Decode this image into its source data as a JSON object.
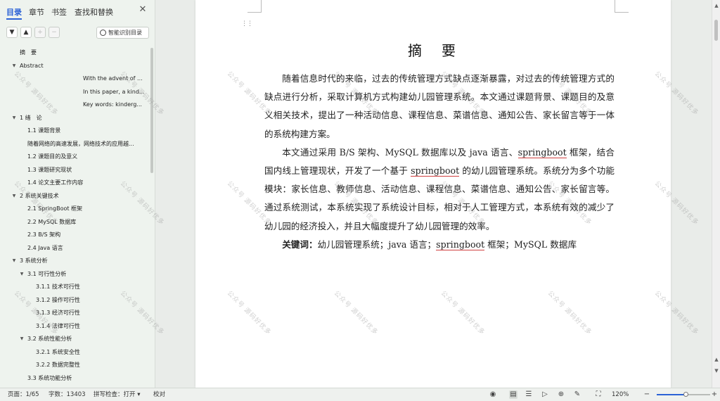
{
  "nav": {
    "tabs": [
      {
        "label": "目录",
        "active": true
      },
      {
        "label": "章节",
        "active": false
      },
      {
        "label": "书签",
        "active": false
      },
      {
        "label": "查找和替换",
        "active": false
      }
    ],
    "close_icon": "close-icon",
    "tools": {
      "collapse_icon": "chevron-down-icon",
      "expand_icon": "chevron-up-icon",
      "add_icon": "plus-icon",
      "remove_icon": "minus-icon",
      "smart_label": "智能识别目录"
    },
    "outline": [
      {
        "label": "摘　要",
        "level": 1,
        "caret": false
      },
      {
        "label": "Abstract",
        "level": 1,
        "caret": true
      },
      {
        "label": "With the advent of ...",
        "level": 4,
        "caret": false
      },
      {
        "label": "In this paper, a kind...",
        "level": 4,
        "caret": false
      },
      {
        "label": "Key words: kinderg...",
        "level": 4,
        "caret": false
      },
      {
        "label": "1  绪　论",
        "level": 1,
        "caret": true
      },
      {
        "label": "1.1 课题背景",
        "level": 2,
        "caret": false
      },
      {
        "label": "随着网络的高速发展，网络技术的应用越...",
        "level": 2,
        "caret": false
      },
      {
        "label": "1.2  课题目的及意义",
        "level": 2,
        "caret": false
      },
      {
        "label": "1.3 课题研究现状",
        "level": 2,
        "caret": false
      },
      {
        "label": "1.4  论文主要工作内容",
        "level": 2,
        "caret": false
      },
      {
        "label": "2  系统关键技术",
        "level": 1,
        "caret": true
      },
      {
        "label": "2.1   SpringBoot 框架",
        "level": 2,
        "caret": false
      },
      {
        "label": "2.2 MySQL 数据库",
        "level": 2,
        "caret": false
      },
      {
        "label": "2.3 B/S 架构",
        "level": 2,
        "caret": false
      },
      {
        "label": "2.4 Java 语言",
        "level": 2,
        "caret": false
      },
      {
        "label": "3  系统分析",
        "level": 1,
        "caret": true
      },
      {
        "label": "3.1  可行性分析",
        "level": 2,
        "caret": true
      },
      {
        "label": "3.1.1  技术可行性",
        "level": 3,
        "caret": false
      },
      {
        "label": "3.1.2  操作可行性",
        "level": 3,
        "caret": false
      },
      {
        "label": "3.1.3  经济可行性",
        "level": 3,
        "caret": false
      },
      {
        "label": "3.1.4  法律可行性",
        "level": 3,
        "caret": false
      },
      {
        "label": "3.2  系统性能分析",
        "level": 2,
        "caret": true
      },
      {
        "label": "3.2.1  系统安全性",
        "level": 3,
        "caret": false
      },
      {
        "label": "3.2.2  数据完整性",
        "level": 3,
        "caret": false
      },
      {
        "label": "3.3  系统功能分析",
        "level": 2,
        "caret": false
      }
    ]
  },
  "document": {
    "title": "摘　要",
    "para1": "随着信息时代的来临，过去的传统管理方式缺点逐渐暴露，对过去的传统管理方式的缺点进行分析，采取计算机方式构建幼儿园管理系统。本文通过课题背景、课题目的及意义相关技术，提出了一种活动信息、课程信息、菜谱信息、通知公告、家长留言等于一体的系统构建方案。",
    "para2_a": "本文通过采用 B/S 架构、MySQL 数据库以及 java 语言、",
    "para2_b": "springboot",
    "para2_c": " 框架，结合国内线上管理现状，开发了一个基于 ",
    "para2_d": "springboot",
    "para2_e": " 的幼儿园管理系统。系统分为多个功能模块：家长信息、教师信息、活动信息、课程信息、菜谱信息、通知公告、家长留言等。通过系统测试，本系统实现了系统设计目标，相对于人工管理方式，本系统有效的减少了幼儿园的经济投入，并且大幅度提升了幼儿园管理的效率。",
    "keywords_label": "关键词：",
    "keywords_a": "幼儿园管理系统；java 语言；",
    "keywords_b": "springboot",
    "keywords_c": " 框架；MySQL 数据库",
    "watermark": "公众号 源码好优多"
  },
  "status": {
    "page": "页面：1/65",
    "words": "字数：13403",
    "spell": "拼写检查：打开 ▾",
    "proof": "校对",
    "zoom": "120%",
    "zoom_fraction": 0.55,
    "icons": [
      "eye-icon",
      "page-view-icon",
      "outline-view-icon",
      "play-icon",
      "web-icon",
      "pen-icon",
      "fit-page-icon",
      "zoom-out-icon",
      "zoom-in-icon"
    ]
  }
}
